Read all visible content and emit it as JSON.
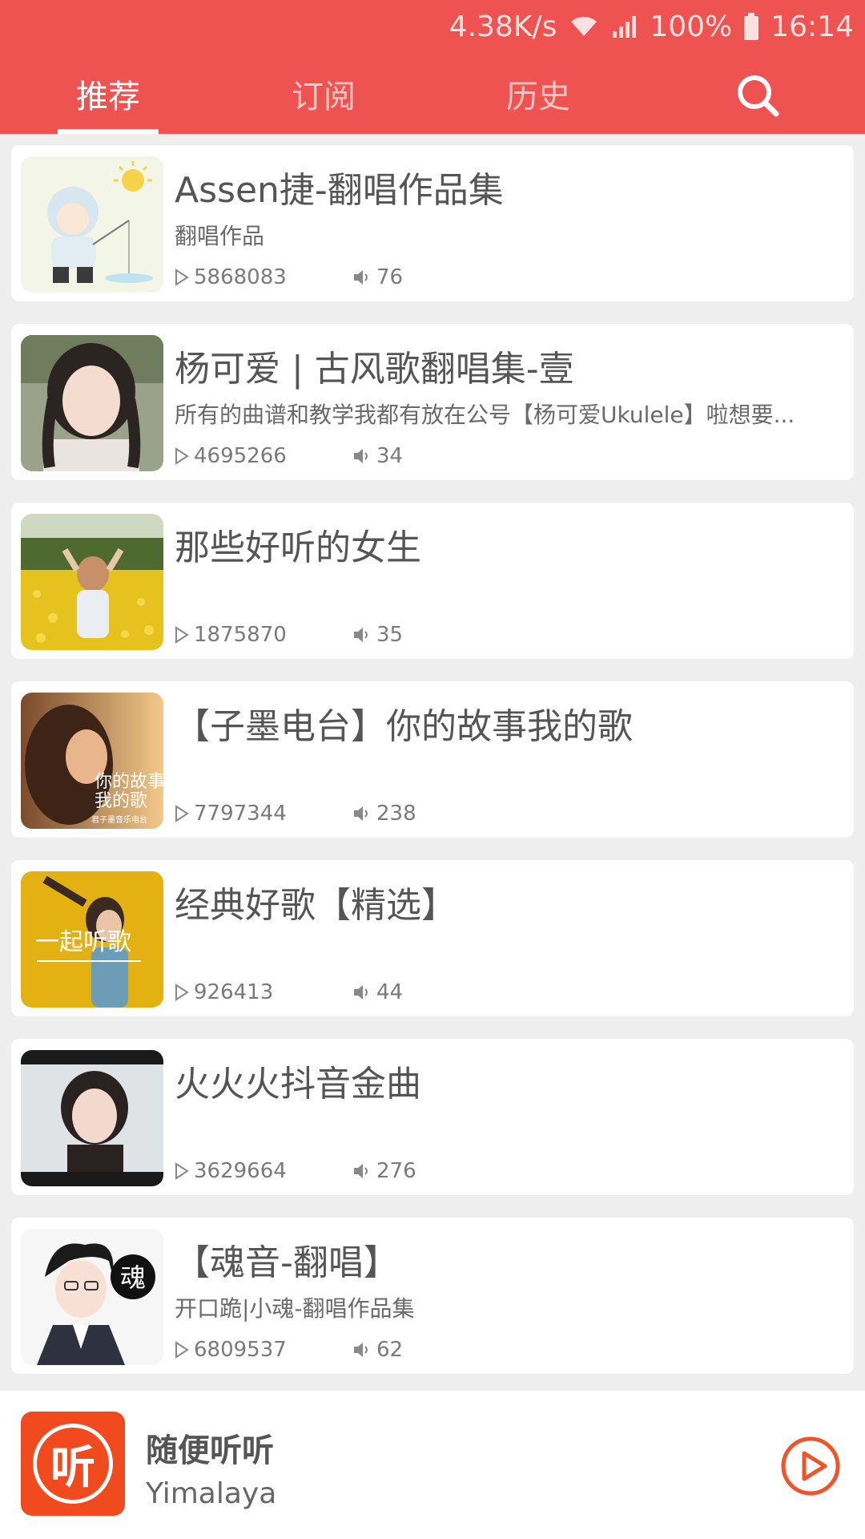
{
  "status_bar": {
    "net_speed": "4.38K/s",
    "battery": "100%",
    "time": "16:14"
  },
  "tabs": [
    {
      "label": "推荐",
      "active": true
    },
    {
      "label": "订阅",
      "active": false
    },
    {
      "label": "历史",
      "active": false
    }
  ],
  "search_icon": "search-icon",
  "albums": [
    {
      "title": "Assen捷-翻唱作品集",
      "subtitle": "翻唱作品",
      "plays": "5868083",
      "tracks": "76"
    },
    {
      "title": "杨可爱 | 古风歌翻唱集-壹",
      "subtitle": "所有的曲谱和教学我都有放在公号【杨可爱Ukulele】啦想要...",
      "plays": "4695266",
      "tracks": "34"
    },
    {
      "title": "那些好听的女生",
      "subtitle": "",
      "plays": "1875870",
      "tracks": "35"
    },
    {
      "title": "【子墨电台】你的故事我的歌",
      "subtitle": "",
      "plays": "7797344",
      "tracks": "238"
    },
    {
      "title": "经典好歌【精选】",
      "subtitle": "",
      "plays": "926413",
      "tracks": "44"
    },
    {
      "title": "火火火抖音金曲",
      "subtitle": "",
      "plays": "3629664",
      "tracks": "276"
    },
    {
      "title": "【魂音-翻唱】",
      "subtitle": "开口跪|小魂-翻唱作品集",
      "plays": "6809537",
      "tracks": "62"
    }
  ],
  "thumb_text": {
    "album4_line1": "你的故事",
    "album4_line2": "我的歌",
    "album4_line3": "君子墨音乐电台",
    "album5": "一起听歌",
    "album7": "魂"
  },
  "player": {
    "title": "随便听听",
    "artist": "Yimalaya",
    "logo_char": "听"
  },
  "colors": {
    "accent": "#ee5352",
    "logo": "#f14a1e",
    "play": "#f0552a"
  }
}
